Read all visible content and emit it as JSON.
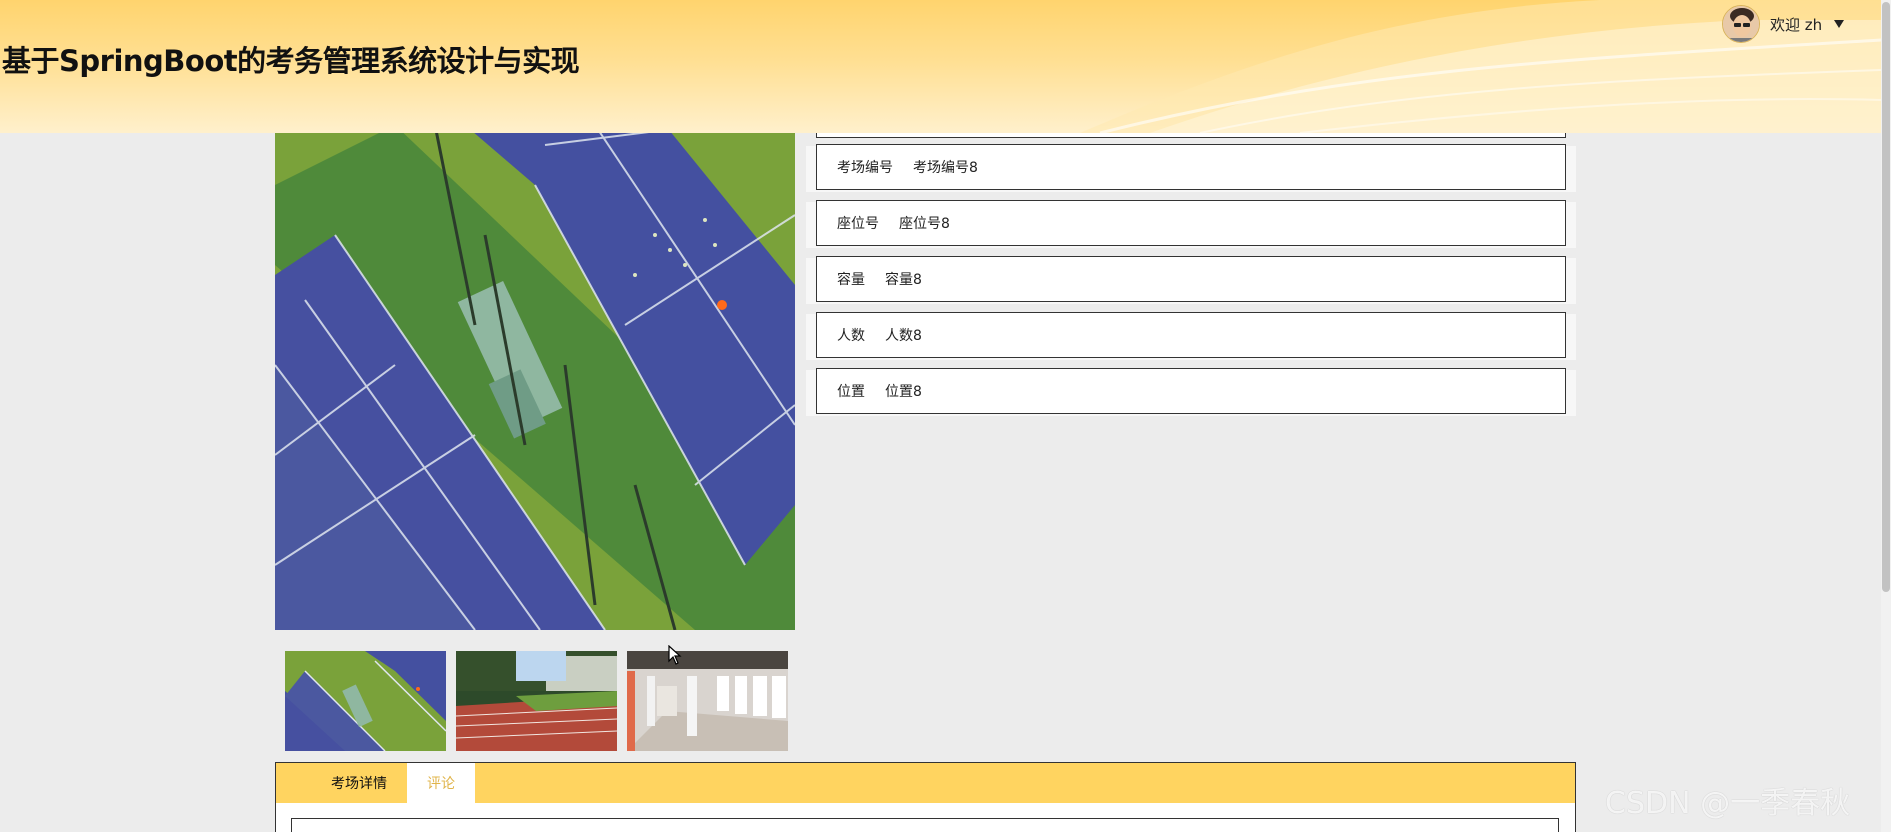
{
  "header": {
    "title": "基于SpringBoot的考务管理系统设计与实现",
    "welcome": "欢迎 zh"
  },
  "fields": [
    {
      "label": "考场编号",
      "value": "考场编号8"
    },
    {
      "label": "座位号",
      "value": "座位号8"
    },
    {
      "label": "容量",
      "value": "容量8"
    },
    {
      "label": "人数",
      "value": "人数8"
    },
    {
      "label": "位置",
      "value": "位置8"
    }
  ],
  "tabs": [
    {
      "label": "考场详情",
      "active": true
    },
    {
      "label": "评论",
      "active": false
    }
  ],
  "watermark": "CSDN @一季春秋",
  "colors": {
    "accent": "#ffd460",
    "tab_inactive_text": "#e0b44a",
    "background": "#ececec"
  }
}
